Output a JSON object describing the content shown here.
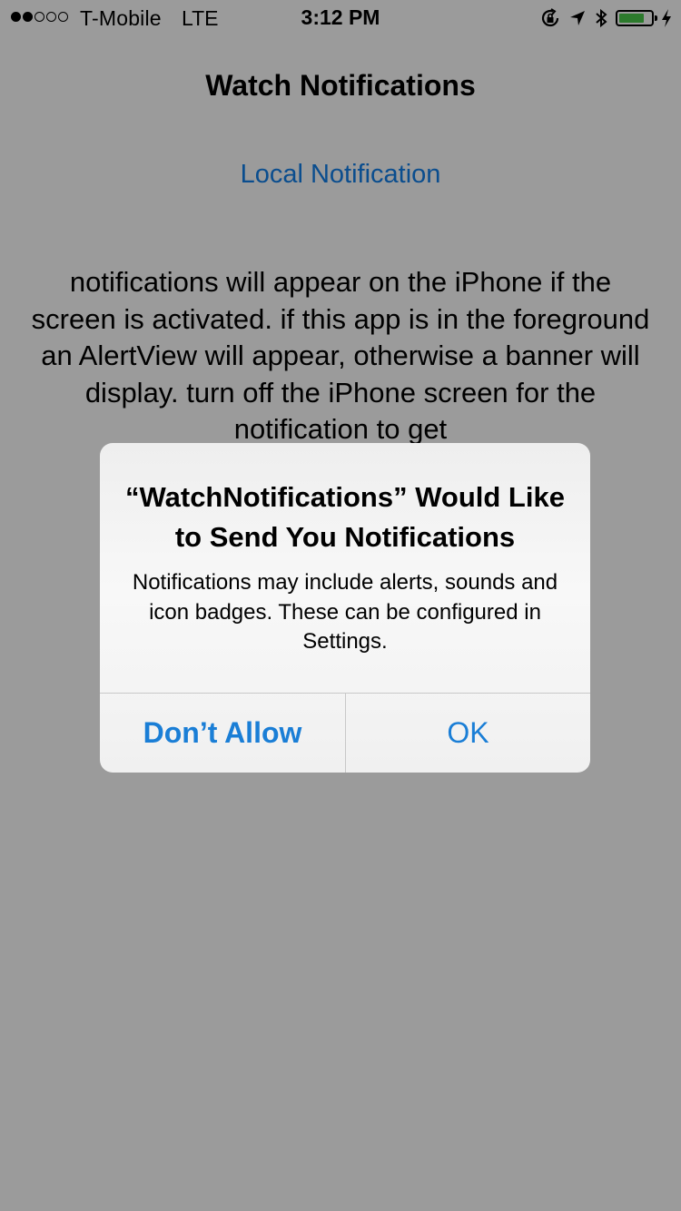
{
  "status_bar": {
    "signal_dots_filled": 2,
    "signal_dots_total": 5,
    "carrier": "T-Mobile",
    "network": "LTE",
    "time": "3:12 PM",
    "icons": [
      "rotation-lock-icon",
      "location-arrow-icon",
      "bluetooth-icon",
      "battery-icon",
      "charging-bolt-icon"
    ],
    "battery_level": 0.8
  },
  "page": {
    "title": "Watch Notifications",
    "local_notification_button": "Local Notification",
    "description": "notifications will appear on the iPhone if the screen is activated. if this app is in the foreground an AlertView will appear, otherwise a banner will display. turn off the iPhone screen for the notification to get"
  },
  "alert": {
    "title": "“WatchNotifications” Would Like to Send You Notifications",
    "message": "Notifications may include alerts, sounds and icon badges. These can be configured in Settings.",
    "deny_label": "Don’t Allow",
    "ok_label": "OK"
  },
  "colors": {
    "dimmed_background": "#9b9b9b",
    "link_blue": "#0a4d8e",
    "alert_button_blue": "#1a7ed6",
    "battery_green": "#2c7a2c"
  }
}
